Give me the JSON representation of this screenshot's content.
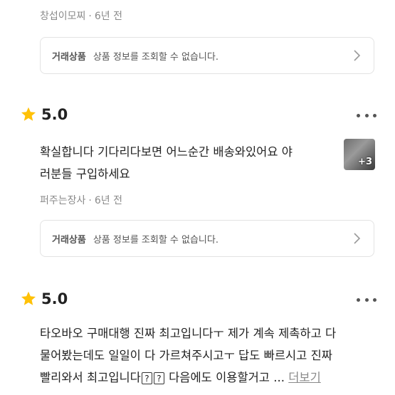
{
  "reviews": [
    {
      "author": "창섭이모찌",
      "time_ago": "6년 전",
      "product": {
        "tag": "거래상품",
        "message": "상품 정보를 조회할 수 없습니다."
      }
    },
    {
      "rating": "5.0",
      "text_line1": "확실합니다 기다리다보면 어느순간 배송와있어요 야",
      "text_line2": "러분들 구입하세요",
      "thumbnail_count": "+3",
      "author": "퍼주는장사",
      "time_ago": "6년 전",
      "product": {
        "tag": "거래상품",
        "message": "상품 정보를 조회할 수 없습니다."
      }
    },
    {
      "rating": "5.0",
      "text_line1": "타오바오 구매대행 진짜 최고입니다ㅜ 제가 계속 제촉하고 다",
      "text_line2": "물어봤는데도 일일이 다 가르쳐주시고ㅜ 답도 빠르시고 진짜",
      "text_line3_start": "빨리와서 최고입니다",
      "unknown_glyph": "?",
      "text_line3_end": " 다음에도 이용할거고",
      "ellipsis": "...",
      "more_label": "더보기"
    }
  ],
  "colors": {
    "star": "#FFC107",
    "meta": "#8a8a8a",
    "border": "#e3e3e3"
  },
  "icons": {
    "star": "star-icon",
    "chevron": "chevron-right-icon",
    "more": "more-horizontal-icon"
  }
}
